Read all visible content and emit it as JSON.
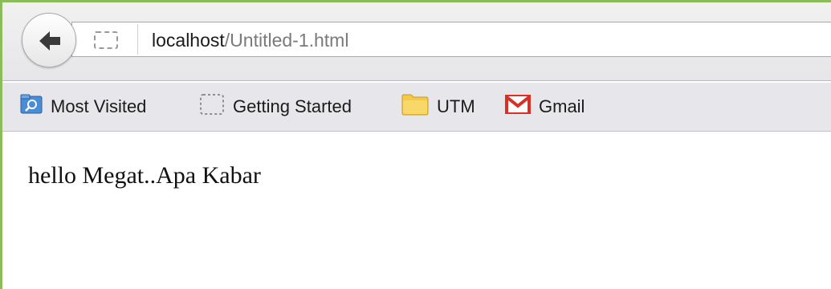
{
  "toolbar": {
    "url_host": "localhost",
    "url_path": "/Untitled-1.html"
  },
  "bookmarks": {
    "items": [
      {
        "label": "Most Visited",
        "icon": "most-visited-icon"
      },
      {
        "label": "Getting Started",
        "icon": "page-placeholder-icon"
      },
      {
        "label": "UTM",
        "icon": "folder-icon"
      },
      {
        "label": "Gmail",
        "icon": "gmail-icon"
      }
    ]
  },
  "page": {
    "text": "hello Megat..Apa Kabar"
  },
  "colors": {
    "window_border": "#8dbb57",
    "folder": "#f3c94b",
    "gmail_red": "#d93025",
    "most_visited_blue": "#4a8cd6"
  }
}
